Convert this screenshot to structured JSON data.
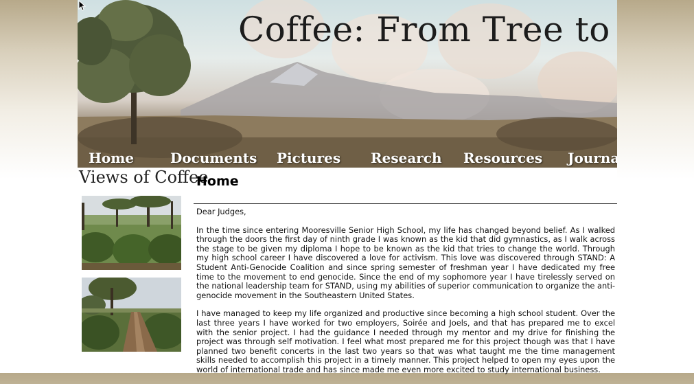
{
  "site": {
    "title": "Coffee: From Tree to Cup"
  },
  "nav": {
    "items": [
      {
        "label": "Home"
      },
      {
        "label": "Documents"
      },
      {
        "label": "Pictures"
      },
      {
        "label": "Research"
      },
      {
        "label": "Resources"
      },
      {
        "label": "Journal"
      }
    ]
  },
  "sidebar": {
    "title": "Views of Coffee"
  },
  "main": {
    "heading": "Home",
    "salutation": "Dear Judges,",
    "paragraphs": [
      "In the time since entering Mooresville Senior High School, my life has changed beyond belief. As I walked through the doors the first day of ninth grade I was known as the kid that did gymnastics, as I walk across the stage to be given my diploma I hope to be known as the kid that tries to change the world. Through my high school career I have discovered a love for activism. This love was discovered through STAND: A Student Anti-Genocide Coalition and since spring semester of freshman year I have dedicated my free time to the movement to end genocide. Since the end of my sophomore year I have tirelessly served on the national leadership team for STAND, using my abilities of superior communication to organize the anti-genocide movement in the Southeastern United States.",
      "I have managed to keep my life organized and productive since becoming a high school student. Over the last three years I have worked for two employers, Soirée and Joels, and that has prepared me to excel with the senior project. I had the guidance I needed through my mentor and my drive for finishing the project was through self motivation. I feel what most prepared me for this project though was that I have planned two benefit concerts in the last two years so that was what taught me the time management skills needed to accomplish this project in a timely manner. This project helped to open my eyes upon the world of international trade and has since made me even more excited to study international business."
    ]
  },
  "colors": {
    "nav_text": "#ffffff",
    "title_text": "#1c1c1c",
    "background_top": "#b7a98a"
  }
}
